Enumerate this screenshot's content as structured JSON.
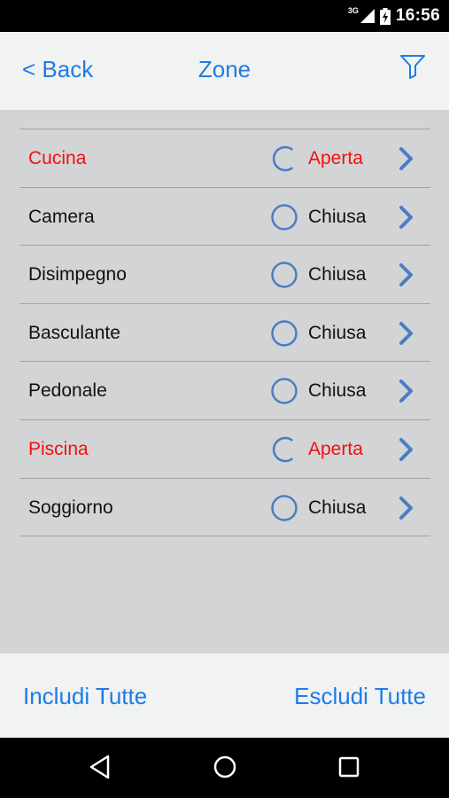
{
  "status_bar": {
    "network": "3G",
    "time": "16:56",
    "icons": [
      "signal-icon",
      "battery-charging-icon"
    ]
  },
  "header": {
    "back_label": "< Back",
    "title": "Zone",
    "filter_icon": "filter-icon"
  },
  "zones": [
    {
      "name": "Cucina",
      "state": "Aperta",
      "open": true
    },
    {
      "name": "Camera",
      "state": "Chiusa",
      "open": false
    },
    {
      "name": "Disimpegno",
      "state": "Chiusa",
      "open": false
    },
    {
      "name": "Basculante",
      "state": "Chiusa",
      "open": false
    },
    {
      "name": "Pedonale",
      "state": "Chiusa",
      "open": false
    },
    {
      "name": "Piscina",
      "state": "Aperta",
      "open": true
    },
    {
      "name": "Soggiorno",
      "state": "Chiusa",
      "open": false
    }
  ],
  "footer": {
    "include_all_label": "Includi Tutte",
    "exclude_all_label": "Escludi Tutte"
  },
  "system_nav": [
    "back-icon",
    "home-icon",
    "recents-icon"
  ],
  "colors": {
    "accent": "#1d7ce8",
    "open_red": "#f40f0f",
    "icon_blue": "#4b7dc4",
    "list_background": "#d3d4d6",
    "bar_background": "#f1f2f2"
  }
}
